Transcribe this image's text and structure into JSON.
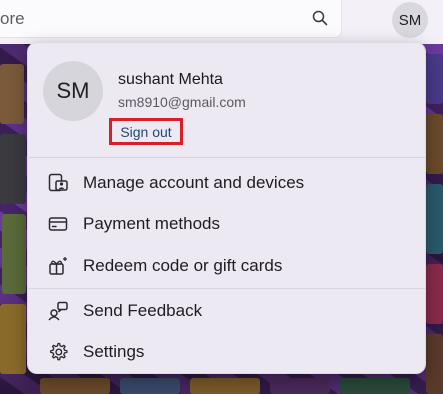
{
  "search": {
    "text": "ore",
    "icon": "search-icon"
  },
  "header": {
    "avatar_initials": "SM"
  },
  "profile": {
    "initials": "SM",
    "name": "sushant Mehta",
    "email": "sm8910@gmail.com",
    "sign_out_label": "Sign out",
    "highlight_color": "#d81e28"
  },
  "menu": {
    "items": [
      {
        "label": "Manage account and devices",
        "icon": "account-devices-icon"
      },
      {
        "label": "Payment methods",
        "icon": "credit-card-icon"
      },
      {
        "label": "Redeem code or gift cards",
        "icon": "gift-redeem-icon"
      },
      {
        "label": "Send Feedback",
        "icon": "feedback-icon"
      },
      {
        "label": "Settings",
        "icon": "gear-icon"
      }
    ]
  }
}
